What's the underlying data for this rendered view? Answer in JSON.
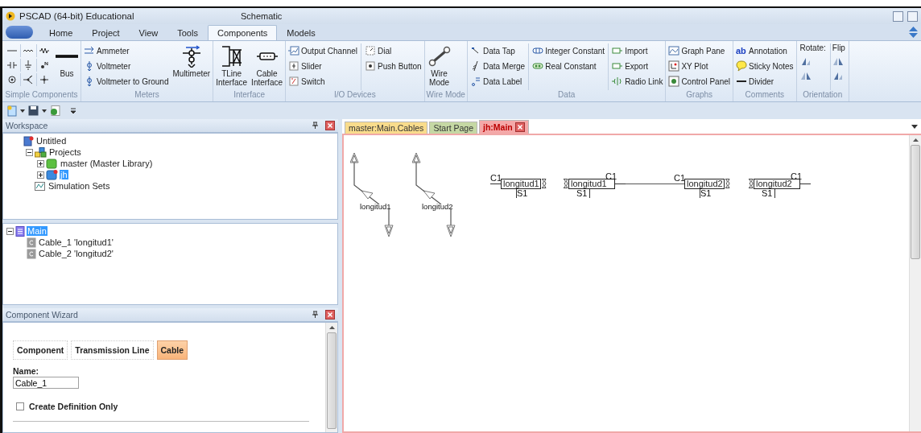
{
  "window": {
    "title": "PSCAD (64-bit) Educational",
    "context": "Schematic"
  },
  "ribbon_tabs": [
    {
      "label": "Home",
      "selected": false
    },
    {
      "label": "Project",
      "selected": false
    },
    {
      "label": "View",
      "selected": false
    },
    {
      "label": "Tools",
      "selected": false
    },
    {
      "label": "Components",
      "selected": true
    },
    {
      "label": "Models",
      "selected": false
    }
  ],
  "ribbon_groups": [
    {
      "label": "Simple Components",
      "columns": [
        {
          "kind": "icon_grid"
        },
        {
          "kind": "large",
          "label": "Bus"
        }
      ]
    },
    {
      "label": "Meters",
      "columns": [
        {
          "kind": "stack",
          "items": [
            {
              "label": "Ammeter"
            },
            {
              "label": "Voltmeter"
            },
            {
              "label": "Voltmeter to Ground"
            }
          ]
        },
        {
          "kind": "large",
          "label": "Multimeter"
        }
      ]
    },
    {
      "label": "Interface",
      "columns": [
        {
          "kind": "large",
          "label": "TLine Interface"
        },
        {
          "kind": "large",
          "label": "Cable Interface"
        }
      ]
    },
    {
      "label": "I/O Devices",
      "columns": [
        {
          "kind": "stack",
          "items": [
            {
              "label": "Output Channel"
            },
            {
              "label": "Slider"
            },
            {
              "label": "Switch"
            }
          ]
        },
        {
          "kind": "stack",
          "items": [
            {
              "label": "Dial"
            },
            {
              "label": "Push Button"
            }
          ]
        }
      ]
    },
    {
      "label": "Wire Mode",
      "columns": [
        {
          "kind": "large",
          "label": "Wire Mode"
        }
      ]
    },
    {
      "label": "Data",
      "columns": [
        {
          "kind": "stack",
          "items": [
            {
              "label": "Data Tap"
            },
            {
              "label": "Data Merge"
            },
            {
              "label": "Data Label"
            }
          ]
        },
        {
          "kind": "stack",
          "items": [
            {
              "label": "Integer Constant"
            },
            {
              "label": "Real Constant"
            }
          ]
        },
        {
          "kind": "stack",
          "items": [
            {
              "label": "Import"
            },
            {
              "label": "Export"
            },
            {
              "label": "Radio Link"
            }
          ]
        }
      ]
    },
    {
      "label": "Graphs",
      "columns": [
        {
          "kind": "stack",
          "items": [
            {
              "label": "Graph Pane"
            },
            {
              "label": "XY Plot"
            },
            {
              "label": "Control Panel"
            }
          ]
        }
      ]
    },
    {
      "label": "Comments",
      "columns": [
        {
          "kind": "stack",
          "items": [
            {
              "label": "Annotation",
              "icon_text": "ab"
            },
            {
              "label": "Sticky Notes"
            },
            {
              "label": "Divider"
            }
          ]
        }
      ]
    },
    {
      "label": "Orientation",
      "columns": [
        {
          "kind": "orient",
          "label": "Rotate:"
        },
        {
          "kind": "orient",
          "label": "Flip"
        }
      ]
    }
  ],
  "workspace": {
    "title": "Workspace",
    "tree": [
      {
        "label": "Untitled",
        "selected": false,
        "children": [
          {
            "label": "Projects",
            "selected": false,
            "expanded": true,
            "children": [
              {
                "label": "master (Master Library)",
                "selected": false,
                "expanded": false
              },
              {
                "label": "jh",
                "selected": true,
                "expanded": false
              }
            ]
          },
          {
            "label": "Simulation Sets",
            "selected": false
          }
        ]
      }
    ]
  },
  "outline": {
    "tree": [
      {
        "label": "Main",
        "selected": true,
        "expanded": true,
        "children": [
          {
            "label": "Cable_1 'longitud1'",
            "selected": false
          },
          {
            "label": "Cable_2 'longitud2'",
            "selected": false
          }
        ]
      }
    ]
  },
  "wizard": {
    "title": "Component Wizard",
    "tabs": [
      {
        "label": "Component",
        "selected": false
      },
      {
        "label": "Transmission Line",
        "selected": false
      },
      {
        "label": "Cable",
        "selected": true
      }
    ],
    "name_label": "Name:",
    "name_value": "Cable_1",
    "create_definition_only": {
      "label": "Create Definition Only",
      "checked": false
    }
  },
  "document_tabs": [
    {
      "label": "master:Main.Cables",
      "color": "#f9dc8c",
      "selected": false
    },
    {
      "label": "Start Page",
      "color": "#c5d8a4",
      "selected": false
    },
    {
      "label": "jh:Main",
      "color": "#f4a8a8",
      "selected": true
    }
  ],
  "canvas": {
    "tlines": [
      {
        "label": "longitud1"
      },
      {
        "label": "longitud2"
      }
    ],
    "cables": [
      {
        "kind": "right",
        "name": "longitud1",
        "c_label": "C1",
        "s_label": "S1"
      },
      {
        "kind": "left",
        "name": "longitud1",
        "c_label": "C1",
        "s_label": "S1"
      },
      {
        "kind": "right",
        "name": "longitud2",
        "c_label": "C1",
        "s_label": "S1"
      },
      {
        "kind": "left",
        "name": "longitud2",
        "c_label": "C1",
        "s_label": "S1"
      }
    ]
  }
}
